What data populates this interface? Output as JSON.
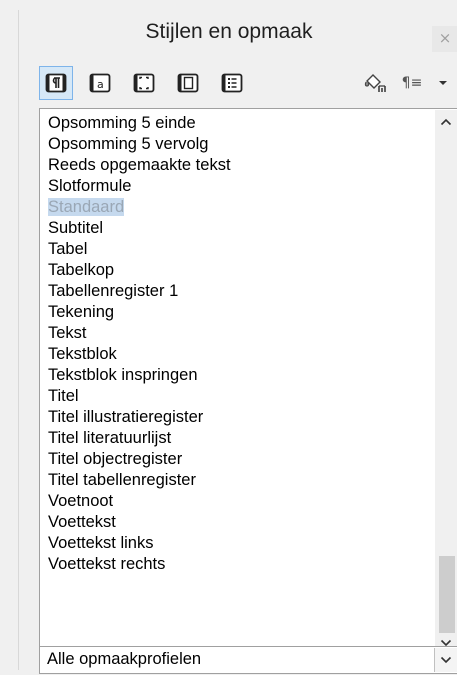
{
  "window": {
    "title": "Stijlen en opmaak",
    "close_label": "×"
  },
  "toolbar": {
    "buttons": [
      {
        "icon": "paragraph-styles-icon",
        "active": true
      },
      {
        "icon": "character-styles-icon",
        "active": false
      },
      {
        "icon": "frame-styles-icon",
        "active": false
      },
      {
        "icon": "page-styles-icon",
        "active": false
      },
      {
        "icon": "list-styles-icon",
        "active": false
      }
    ],
    "fill_format_icon": "fill-format-mode-icon",
    "new_style_icon": "new-style-from-selection-icon",
    "new_style_label": "¶≡",
    "dropdown_icon": "dropdown-arrow-icon"
  },
  "styles_list": {
    "items": [
      {
        "label": "Opsomming 5 einde",
        "selected": false
      },
      {
        "label": "Opsomming 5 vervolg",
        "selected": false
      },
      {
        "label": "Reeds opgemaakte tekst",
        "selected": false
      },
      {
        "label": "Slotformule",
        "selected": false
      },
      {
        "label": "Standaard",
        "selected": true
      },
      {
        "label": "Subtitel",
        "selected": false
      },
      {
        "label": "Tabel",
        "selected": false
      },
      {
        "label": "Tabelkop",
        "selected": false
      },
      {
        "label": "Tabellenregister 1",
        "selected": false
      },
      {
        "label": "Tekening",
        "selected": false
      },
      {
        "label": "Tekst",
        "selected": false
      },
      {
        "label": "Tekstblok",
        "selected": false
      },
      {
        "label": "Tekstblok inspringen",
        "selected": false
      },
      {
        "label": "Titel",
        "selected": false
      },
      {
        "label": "Titel illustratieregister",
        "selected": false
      },
      {
        "label": "Titel literatuurlijst",
        "selected": false
      },
      {
        "label": "Titel objectregister",
        "selected": false
      },
      {
        "label": "Titel tabellenregister",
        "selected": false
      },
      {
        "label": "Voetnoot",
        "selected": false
      },
      {
        "label": "Voettekst",
        "selected": false
      },
      {
        "label": "Voettekst links",
        "selected": false
      },
      {
        "label": "Voettekst rechts",
        "selected": false
      }
    ]
  },
  "filter": {
    "value": "Alle opmaakprofielen"
  },
  "colors": {
    "selection_bg": "#c5d9ee",
    "active_button_bg": "#d6e8f7",
    "active_button_border": "#7eb4ea"
  }
}
